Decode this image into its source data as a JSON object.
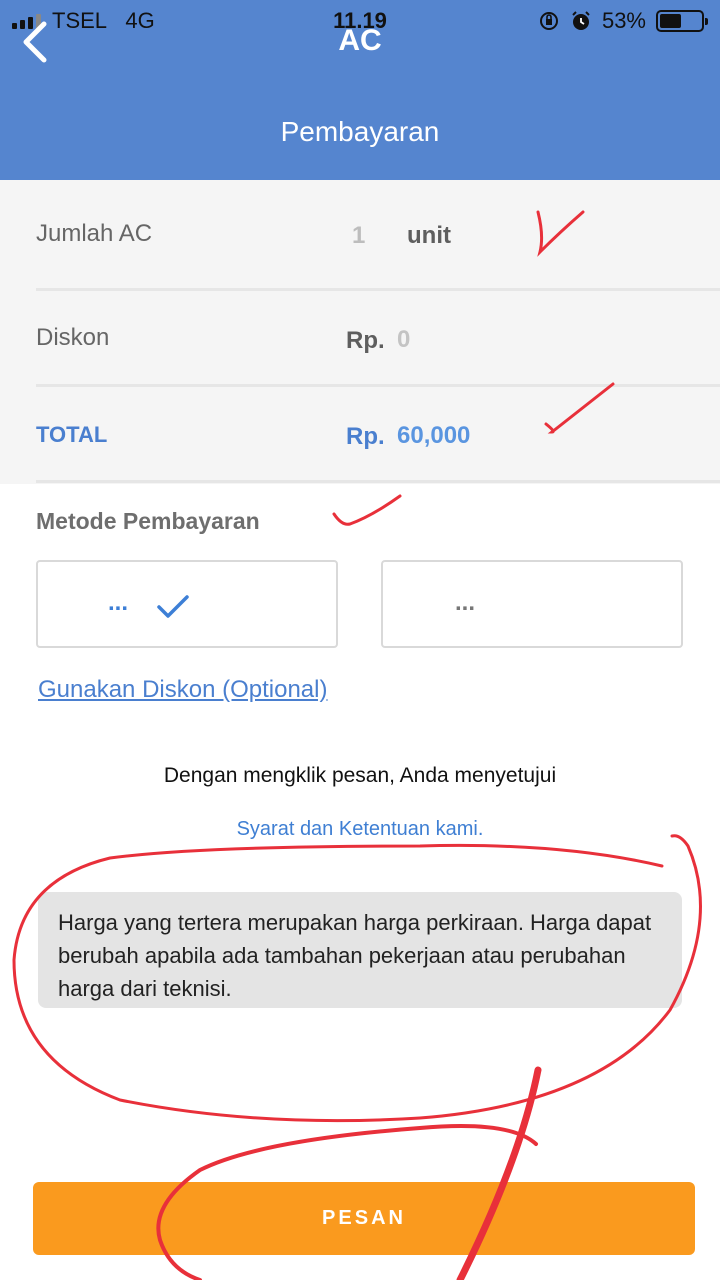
{
  "status_bar": {
    "carrier": "TSEL",
    "network": "4G",
    "time": "11.19",
    "battery_percent": "53%",
    "battery_level": 0.53
  },
  "header": {
    "title": "AC",
    "subtitle": "Pembayaran",
    "background_color": "#5585cf"
  },
  "summary": {
    "units": {
      "label": "Jumlah AC",
      "count": "1",
      "unit": "unit"
    },
    "discount": {
      "label": "Diskon",
      "currency": "Rp.",
      "amount": "0"
    },
    "total": {
      "label": "TOTAL",
      "currency": "Rp.",
      "amount": "60,000",
      "color": "#4a7fcf"
    }
  },
  "payment": {
    "section_title": "Metode Pembayaran",
    "options": [
      {
        "label": "...",
        "selected": true
      },
      {
        "label": "...",
        "selected": false
      }
    ]
  },
  "discount_link": "Gunakan Diskon (Optional)",
  "agreement": {
    "text": "Dengan mengklik pesan, Anda menyetujui",
    "terms_link": "Syarat dan Ketentuan kami."
  },
  "note": "Harga yang tertera merupakan harga perkiraan. Harga dapat berubah apabila ada tambahan pekerjaan atau perubahan harga dari teknisi.",
  "order_button": {
    "label": "PESAN",
    "color": "#fa9a1e"
  },
  "annotation_color": "#e8303a"
}
